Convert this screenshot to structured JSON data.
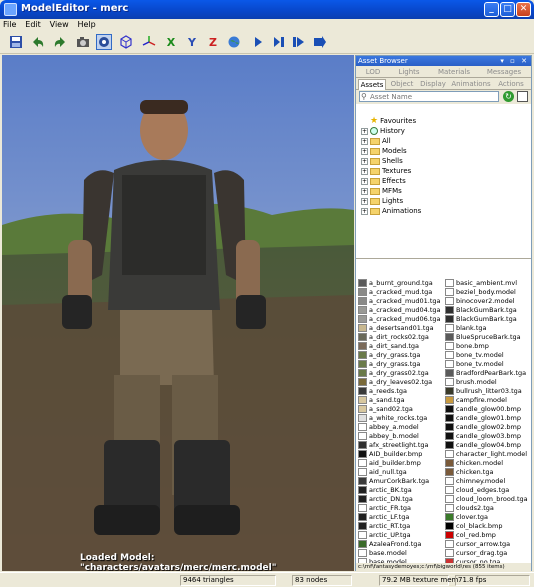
{
  "window": {
    "title": "ModelEditor - merc"
  },
  "menu": [
    "File",
    "Edit",
    "View",
    "Help"
  ],
  "toolbar": {
    "buttons": [
      "save-icon",
      "undo-icon",
      "redo-icon",
      "camera-icon",
      "model-icon",
      "cube-icon",
      "axis-icon",
      "x-axis-icon",
      "y-axis-icon",
      "z-axis-icon",
      "globe-icon",
      "play-icon",
      "play-next-icon",
      "play-end-icon",
      "play-loop-icon"
    ]
  },
  "viewport": {
    "loaded_model": "Loaded Model: \"characters/avatars/merc/merc.model\""
  },
  "status": {
    "triangles": "9464 triangles",
    "nodes": "83 nodes",
    "texmem": "79.2 MB texture mem",
    "fps": "71.8 fps"
  },
  "panel": {
    "title": "Asset Browser",
    "tabs_top": [
      "LOD",
      "Lights",
      "Materials",
      "Messages"
    ],
    "tabs_bottom": [
      "Assets",
      "Object",
      "Display",
      "Animations",
      "Actions"
    ],
    "search_placeholder": "Asset Name",
    "tree": [
      "Favourites",
      "History",
      "All",
      "Models",
      "Shells",
      "Textures",
      "Effects",
      "MFMs",
      "Lights",
      "Animations"
    ],
    "assets_left": [
      "a_burnt_ground.tga",
      "a_cracked_mud.tga",
      "a_cracked_mud01.tga",
      "a_cracked_mud04.tga",
      "a_cracked_mud06.tga",
      "a_desertsand01.tga",
      "a_dirt_rocks02.tga",
      "a_dirt_sand.tga",
      "a_dry_grass.tga",
      "a_dry_grass.tga",
      "a_dry_grass02.tga",
      "a_dry_leaves02.tga",
      "a_reeds.tga",
      "a_sand.tga",
      "a_sand02.tga",
      "a_white_rocks.tga",
      "abbey_a.model",
      "abbey_b.model",
      "afx_streetlight.tga",
      "AID_builder.bmp",
      "aid_builder.bmp",
      "aid_null.tga",
      "AmurCorkBark.tga",
      "arctic_BK.tga",
      "arctic_DN.tga",
      "arctic_FR.tga",
      "arctic_LF.tga",
      "arctic_RT.tga",
      "arctic_UP.tga",
      "AzaleaFrond.tga",
      "base.model",
      "base.model"
    ],
    "assets_right": [
      "basic_ambient.mvl",
      "beziel_body.model",
      "binocover2.model",
      "BlackGumBark.tga",
      "BlackGumBark.tga",
      "blank.tga",
      "BlueSpruceBark.tga",
      "bone.bmp",
      "bone_tv.model",
      "bone_tv.model",
      "BradfordPearBark.tga",
      "brush.model",
      "bullrush_litter03.tga",
      "campfire.model",
      "candle_glow00.bmp",
      "candle_glow01.bmp",
      "candle_glow02.bmp",
      "candle_glow03.bmp",
      "candle_glow04.bmp",
      "character_light.model",
      "chicken.model",
      "chicken.tga",
      "chimney.model",
      "cloud_edges.tga",
      "cloud_loom_brood.tga",
      "clouds2.tga",
      "clover.tga",
      "col_black.bmp",
      "col_red.bmp",
      "cursor_arrow.tga",
      "cursor_drag.tga",
      "cursor_no.tga"
    ],
    "path": "c:\\mf\\fantasydemoyes;c:\\mf\\bigworld\\res (855 items)"
  }
}
